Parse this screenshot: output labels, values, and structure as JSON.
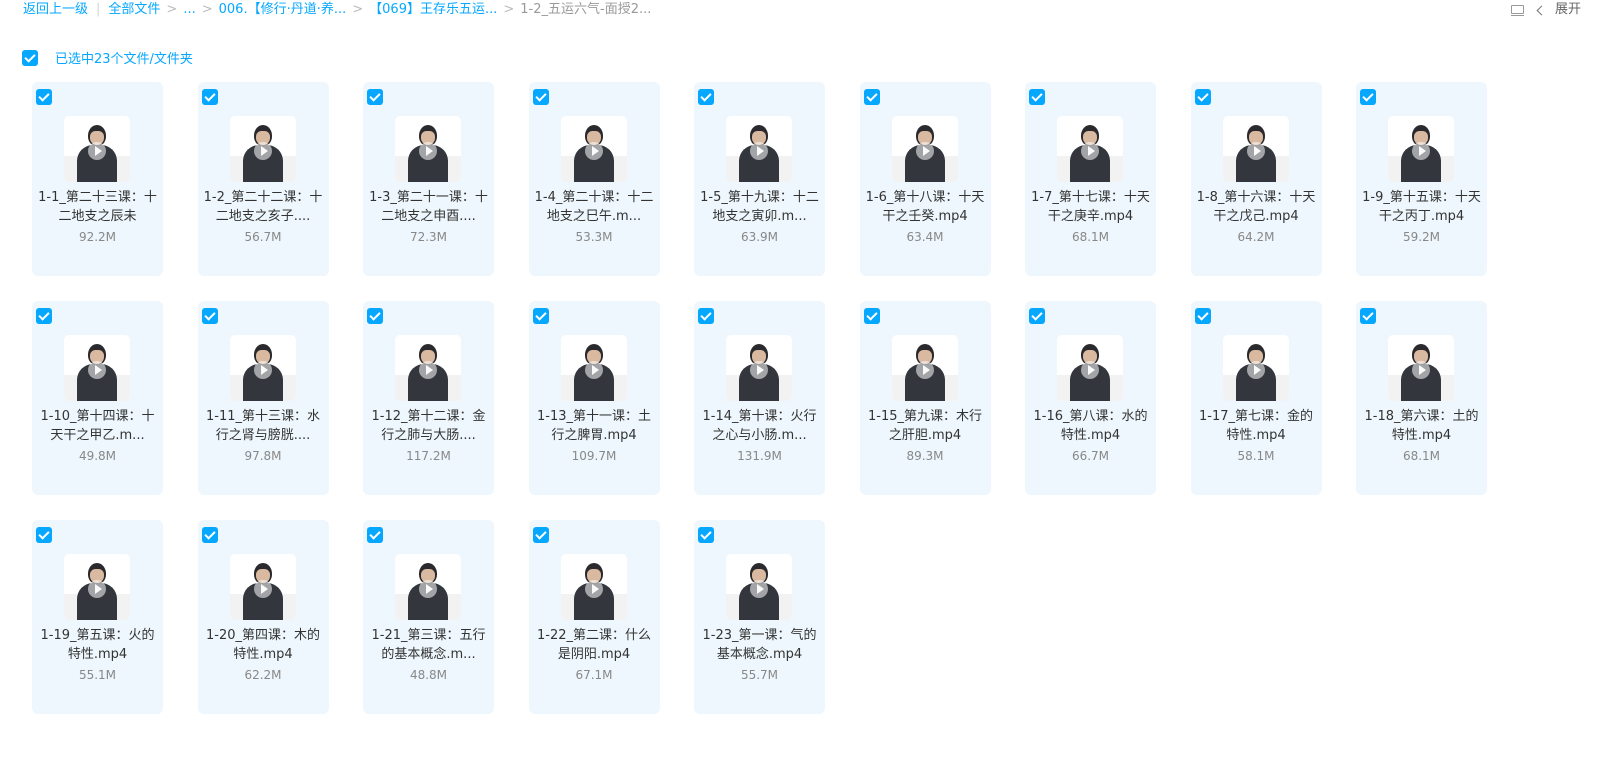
{
  "breadcrumb": {
    "back": "返回上一级",
    "all_files": "全部文件",
    "ellipsis": "...",
    "path1": "006.【修行·丹道·养...",
    "path2": "【069】王存乐五运...",
    "current": "1-2_五运六气-面授2..."
  },
  "top_right": {
    "expand_label": "展开"
  },
  "selection": {
    "label": "已选中23个文件/文件夹"
  },
  "files": [
    {
      "name": "1-1_第二十三课：十二地支之辰未",
      "size": "92.2M"
    },
    {
      "name": "1-2_第二十二课：十二地支之亥子....",
      "size": "56.7M"
    },
    {
      "name": "1-3_第二十一课：十二地支之申酉....",
      "size": "72.3M"
    },
    {
      "name": "1-4_第二十课：十二地支之巳午.m...",
      "size": "53.3M"
    },
    {
      "name": "1-5_第十九课：十二地支之寅卯.m...",
      "size": "63.9M"
    },
    {
      "name": "1-6_第十八课：十天干之壬癸.mp4",
      "size": "63.4M"
    },
    {
      "name": "1-7_第十七课：十天干之庚辛.mp4",
      "size": "68.1M"
    },
    {
      "name": "1-8_第十六课：十天干之戊己.mp4",
      "size": "64.2M"
    },
    {
      "name": "1-9_第十五课：十天干之丙丁.mp4",
      "size": "59.2M"
    },
    {
      "name": "1-10_第十四课：十天干之甲乙.m...",
      "size": "49.8M"
    },
    {
      "name": "1-11_第十三课：水行之肾与膀胱....",
      "size": "97.8M"
    },
    {
      "name": "1-12_第十二课：金行之肺与大肠....",
      "size": "117.2M"
    },
    {
      "name": "1-13_第十一课：土行之脾胃.mp4",
      "size": "109.7M"
    },
    {
      "name": "1-14_第十课：火行之心与小肠.m...",
      "size": "131.9M"
    },
    {
      "name": "1-15_第九课：木行之肝胆.mp4",
      "size": "89.3M"
    },
    {
      "name": "1-16_第八课：水的特性.mp4",
      "size": "66.7M"
    },
    {
      "name": "1-17_第七课：金的特性.mp4",
      "size": "58.1M"
    },
    {
      "name": "1-18_第六课：土的特性.mp4",
      "size": "68.1M"
    },
    {
      "name": "1-19_第五课：火的特性.mp4",
      "size": "55.1M"
    },
    {
      "name": "1-20_第四课：木的特性.mp4",
      "size": "62.2M"
    },
    {
      "name": "1-21_第三课：五行的基本概念.m...",
      "size": "48.8M"
    },
    {
      "name": "1-22_第二课：什么是阴阳.mp4",
      "size": "67.1M"
    },
    {
      "name": "1-23_第一课：气的基本概念.mp4",
      "size": "55.7M"
    }
  ],
  "colors": {
    "accent": "#06a7ff",
    "card_bg": "#eef7fd"
  },
  "icons": {
    "checkbox": "checkbox-checked-icon",
    "play": "play-icon",
    "list_view": "list-view-icon",
    "chevron": "chevron-left-icon"
  }
}
